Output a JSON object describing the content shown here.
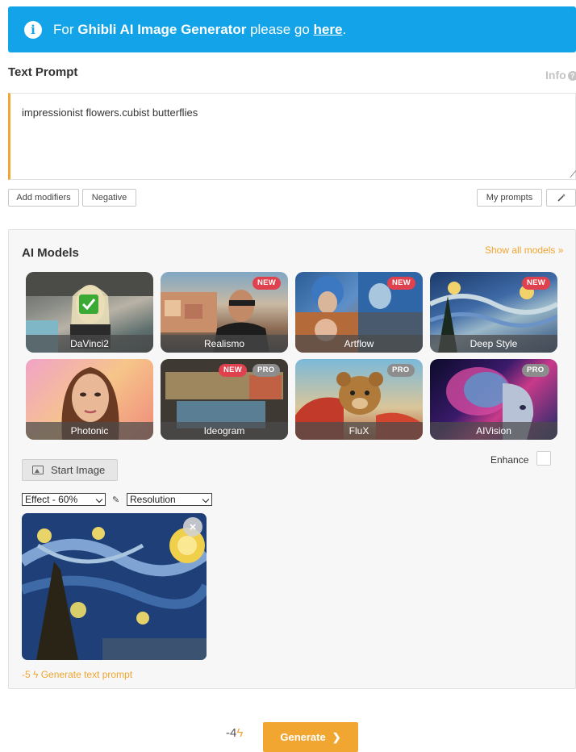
{
  "banner": {
    "prefix": "For ",
    "bold_name": "Ghibli AI Image Generator",
    "middle": " please go ",
    "link": "here",
    "suffix": "."
  },
  "prompt": {
    "label": "Text Prompt",
    "info_label": "Info",
    "value": "impressionist flowers.cubist butterflies"
  },
  "toolbar": {
    "add_modifiers": "Add modifiers",
    "negative": "Negative",
    "my_prompts": "My prompts"
  },
  "models": {
    "title": "AI Models",
    "show_all": "Show all models",
    "items": [
      {
        "name": "DaVinci2",
        "badges": []
      },
      {
        "name": "Realismo",
        "badges": [
          "NEW"
        ]
      },
      {
        "name": "Artflow",
        "badges": [
          "NEW"
        ]
      },
      {
        "name": "Deep Style",
        "badges": [
          "NEW"
        ]
      },
      {
        "name": "Photonic",
        "badges": []
      },
      {
        "name": "Ideogram",
        "badges": [
          "NEW",
          "PRO"
        ]
      },
      {
        "name": "FluX",
        "badges": [
          "PRO"
        ]
      },
      {
        "name": "AIVision",
        "badges": [
          "PRO"
        ]
      }
    ],
    "selected_index": 0
  },
  "start_image": {
    "button": "Start Image",
    "enhance_label": "Enhance",
    "effect_selected": "Effect - 60%",
    "resolution_selected": "Resolution",
    "generate_text_prompt": "-5 ϟ Generate text prompt",
    "gen_cost": "-5",
    "gen_label": "Generate text prompt"
  },
  "footer": {
    "cost": "-4",
    "generate": "Generate"
  },
  "colors": {
    "banner": "#12a3e8",
    "accent": "#f0a630",
    "new_badge": "#e0414e",
    "pro_badge": "#8d8d8d"
  }
}
